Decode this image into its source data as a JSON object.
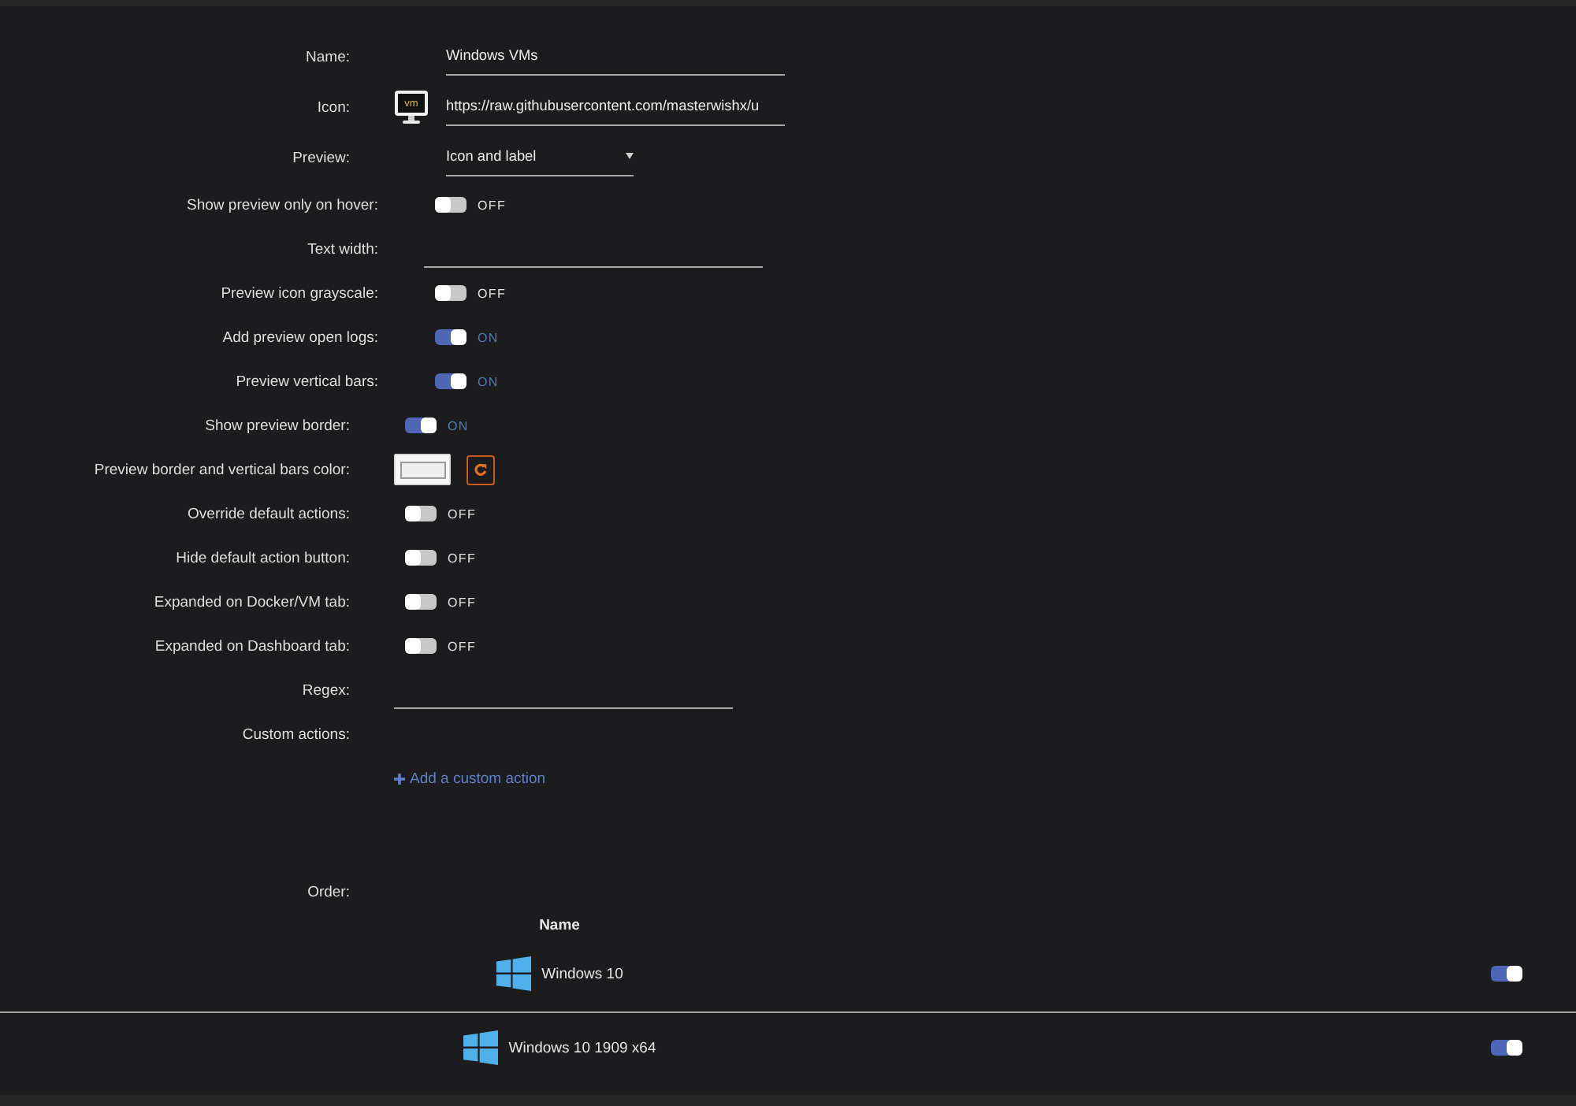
{
  "form": {
    "sections": [
      {
        "fields": [
          {
            "kind": "text",
            "label": "Name:",
            "value": "Windows VMs"
          },
          {
            "kind": "icon_url",
            "label": "Icon:",
            "icon_caption": "vm",
            "value": "https://raw.githubusercontent.com/masterwishx/u"
          },
          {
            "kind": "select",
            "label": "Preview:",
            "value": "Icon and label"
          }
        ]
      },
      {
        "fields": [
          {
            "kind": "toggle",
            "label": "Show preview only on hover:",
            "on": false,
            "state_text": "OFF"
          },
          {
            "kind": "text",
            "label": "Text width:"
          },
          {
            "kind": "toggle",
            "label": "Preview icon grayscale:",
            "on": false,
            "state_text": "OFF"
          },
          {
            "kind": "toggle",
            "label": "Add preview open logs:",
            "on": true,
            "state_text": "ON"
          },
          {
            "kind": "toggle",
            "label": "Preview vertical bars:",
            "on": true,
            "state_text": "ON"
          }
        ]
      },
      {
        "fields": [
          {
            "kind": "toggle",
            "label": "Show preview border:",
            "on": true,
            "state_text": "ON"
          },
          {
            "kind": "color",
            "label": "Preview border and vertical bars color:",
            "color": "#eeeeee"
          },
          {
            "kind": "toggle",
            "label": "Override default actions:",
            "on": false,
            "state_text": "OFF"
          },
          {
            "kind": "toggle",
            "label": "Hide default action button:",
            "on": false,
            "state_text": "OFF"
          },
          {
            "kind": "toggle",
            "label": "Expanded on Docker/VM tab:",
            "on": false,
            "state_text": "OFF"
          },
          {
            "kind": "toggle",
            "label": "Expanded on Dashboard tab:",
            "on": false,
            "state_text": "OFF"
          },
          {
            "kind": "text",
            "label": "Regex:"
          },
          {
            "kind": "actions",
            "label": "Custom actions:",
            "link": "Add a custom action"
          }
        ]
      }
    ]
  },
  "order": {
    "label": "Order:",
    "columns": [
      "Name"
    ],
    "rows": [
      {
        "name": "Windows 10",
        "on": true
      },
      {
        "name": "Windows 10 1909 x64",
        "on": true
      }
    ]
  }
}
